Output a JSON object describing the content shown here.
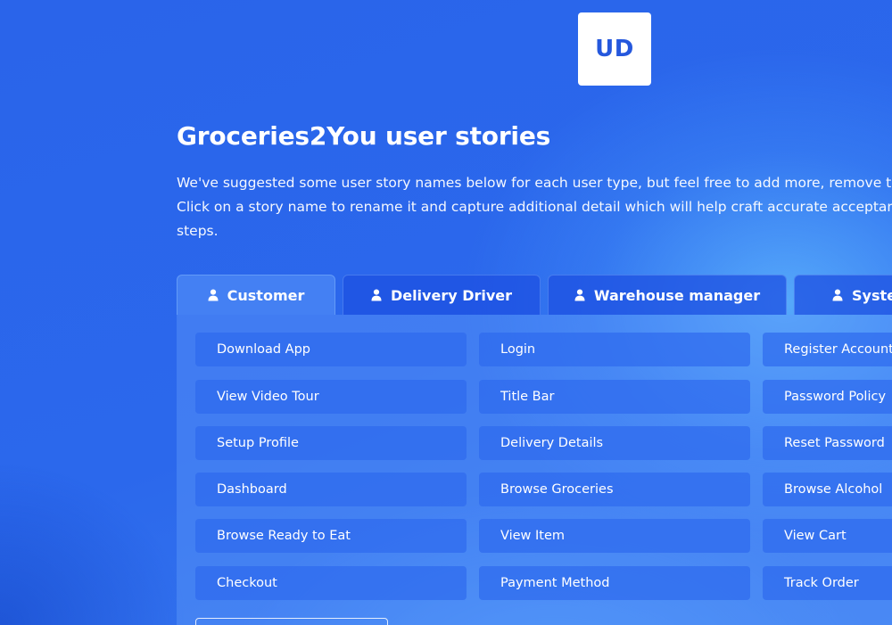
{
  "logo": {
    "text": "UD"
  },
  "title": "Groceries2You user stories",
  "intro": {
    "line1": "We've suggested some user story names below for each user type, but feel free to add more, remove them",
    "line2": "Click on a story name to rename it and capture additional detail which will help craft accurate acceptance",
    "line3": "steps."
  },
  "tabs": [
    {
      "label": "Customer",
      "icon": "person-icon",
      "active": true
    },
    {
      "label": "Delivery Driver",
      "icon": "person-icon",
      "active": false
    },
    {
      "label": "Warehouse manager",
      "icon": "person-icon",
      "active": false
    },
    {
      "label": "System",
      "icon": "person-icon",
      "active": false
    }
  ],
  "stories": [
    [
      "Download App",
      "Login",
      "Register Account"
    ],
    [
      "View Video Tour",
      "Title Bar",
      "Password Policy"
    ],
    [
      "Setup Profile",
      "Delivery Details",
      "Reset Password"
    ],
    [
      "Dashboard",
      "Browse Groceries",
      "Browse Alcohol"
    ],
    [
      "Browse Ready to Eat",
      "View Item",
      "View Cart"
    ],
    [
      "Checkout",
      "Payment Method",
      "Track Order"
    ]
  ],
  "colors": {
    "background": "#2b68ec",
    "logo_text": "#2558dd",
    "text": "#ffffff"
  }
}
